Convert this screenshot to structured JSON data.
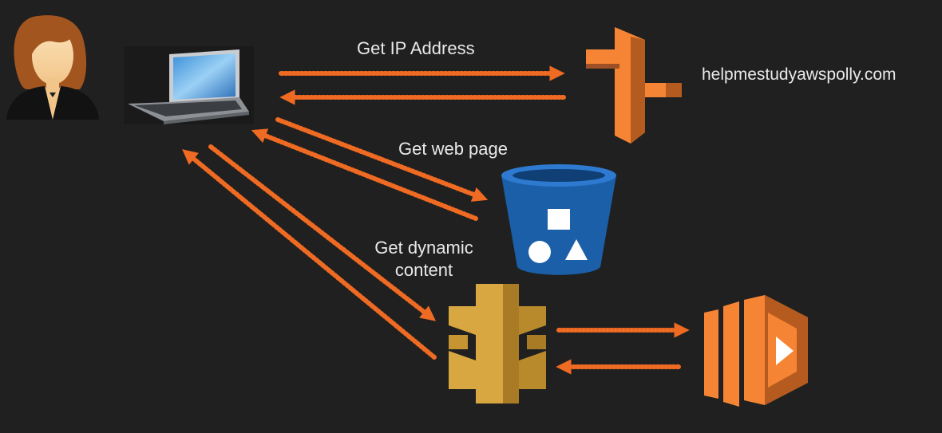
{
  "diagram": {
    "labels": {
      "get_ip": "Get IP Address",
      "domain": "helpmestudyawspolly.com",
      "get_web_page": "Get web page",
      "get_dynamic_line1": "Get dynamic",
      "get_dynamic_line2": "content"
    },
    "nodes": [
      {
        "id": "user",
        "icon": "user-avatar-icon"
      },
      {
        "id": "laptop",
        "icon": "laptop-tablet-icon"
      },
      {
        "id": "route53",
        "icon": "route53-dns-icon"
      },
      {
        "id": "s3",
        "icon": "s3-bucket-icon"
      },
      {
        "id": "api_gateway",
        "icon": "api-gateway-icon"
      },
      {
        "id": "lambda",
        "icon": "lambda-icon"
      }
    ],
    "edges": [
      {
        "from": "laptop",
        "to": "route53"
      },
      {
        "from": "route53",
        "to": "laptop"
      },
      {
        "from": "laptop",
        "to": "s3"
      },
      {
        "from": "s3",
        "to": "laptop"
      },
      {
        "from": "laptop",
        "to": "api_gateway"
      },
      {
        "from": "api_gateway",
        "to": "laptop"
      },
      {
        "from": "api_gateway",
        "to": "lambda"
      },
      {
        "from": "lambda",
        "to": "api_gateway"
      }
    ],
    "colors": {
      "background": "#202020",
      "arrow": "#ef6a22",
      "aws_orange": "#f58534",
      "aws_orange_dark": "#9d5025",
      "s3_blue": "#1b5fa8",
      "gateway_gold": "#d9a741",
      "text": "#e9e9e9"
    }
  }
}
